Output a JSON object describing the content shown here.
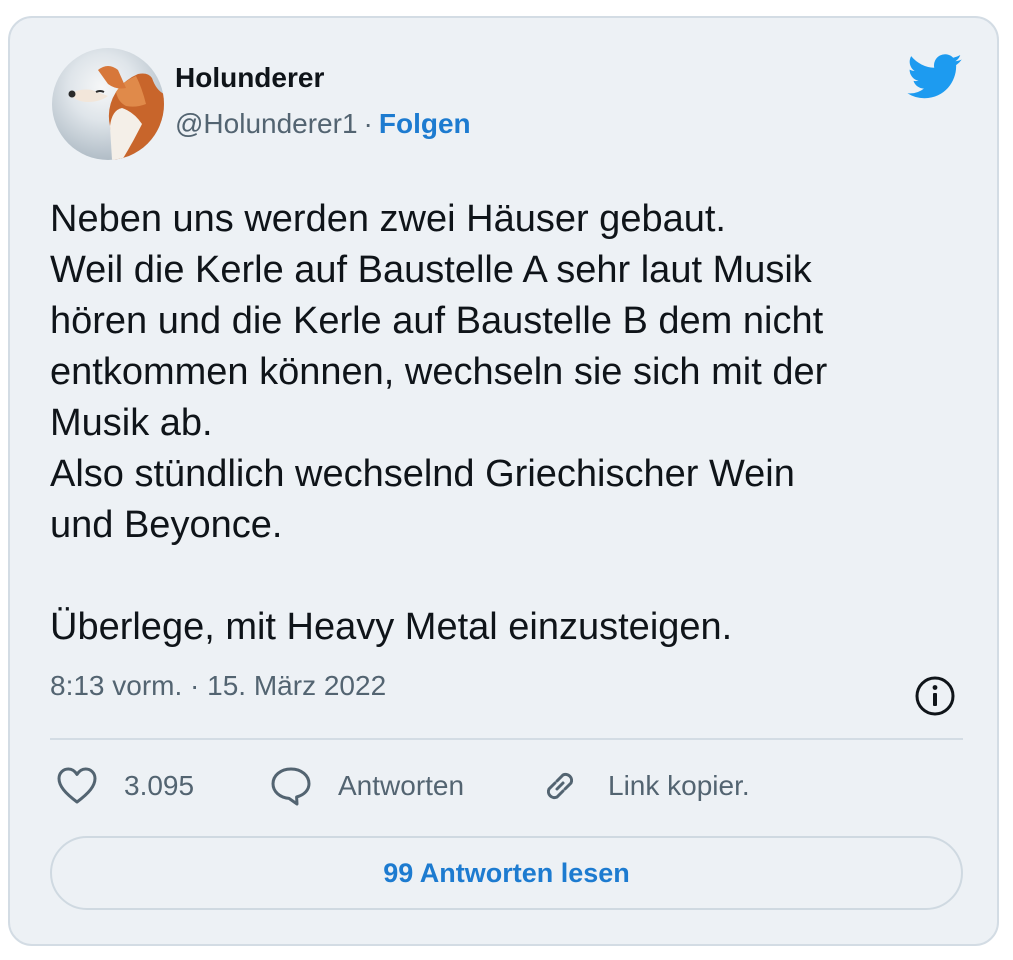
{
  "author": {
    "name": "Holunderer",
    "handle": "@Holunderer1",
    "separator": "·",
    "follow_label": "Folgen"
  },
  "tweet": {
    "lines": [
      "Neben uns werden zwei Häuser gebaut.",
      "Weil die Kerle auf Baustelle A sehr laut Musik",
      "hören und die Kerle auf Baustelle B dem nicht",
      "entkommen können, wechseln sie sich mit der",
      "Musik ab.",
      "Also stündlich wechselnd Griechischer Wein",
      "und Beyonce.",
      "",
      "Überlege, mit Heavy Metal einzusteigen."
    ],
    "timestamp": "8:13 vorm. · 15. März 2022"
  },
  "actions": {
    "like_count": "3.095",
    "reply_label": "Antworten",
    "copy_link_label": "Link kopier."
  },
  "read_replies_label": "99 Antworten lesen",
  "icons": {
    "logo": "twitter-bird-icon",
    "info": "info-icon",
    "like": "heart-icon",
    "reply": "speech-bubble-icon",
    "link": "link-icon"
  },
  "colors": {
    "card_background": "#edf1f5",
    "accent": "#1d7bd0",
    "twitter_blue": "#1d9bf0",
    "text_primary": "#0f1419",
    "text_secondary": "#536471"
  }
}
